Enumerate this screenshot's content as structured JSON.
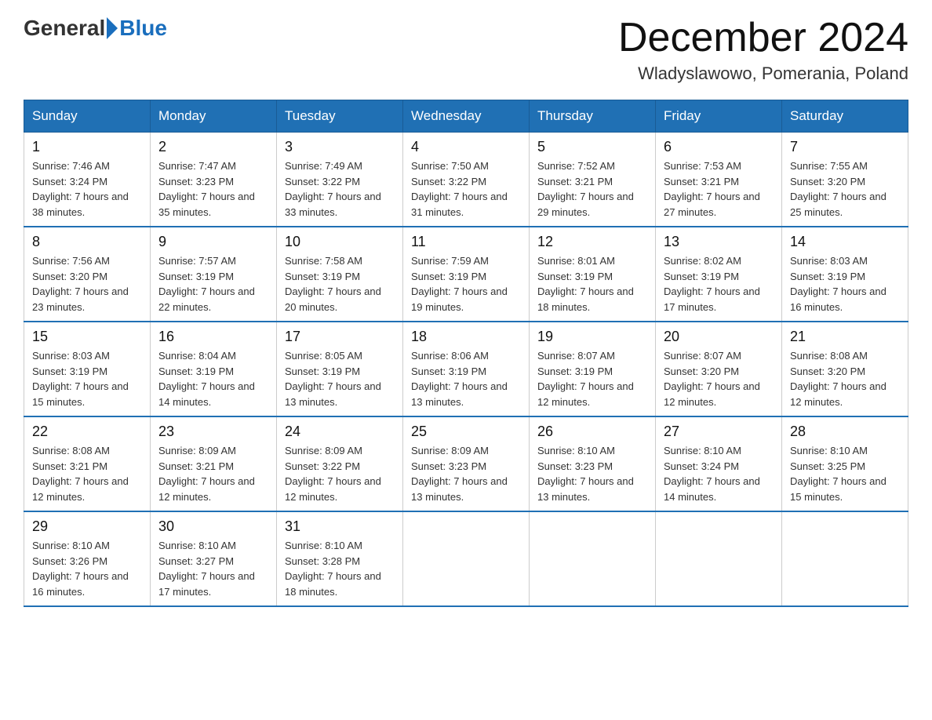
{
  "logo": {
    "general": "General",
    "blue": "Blue"
  },
  "title": "December 2024",
  "location": "Wladyslawowo, Pomerania, Poland",
  "days_of_week": [
    "Sunday",
    "Monday",
    "Tuesday",
    "Wednesday",
    "Thursday",
    "Friday",
    "Saturday"
  ],
  "weeks": [
    [
      {
        "day": "1",
        "sunrise": "7:46 AM",
        "sunset": "3:24 PM",
        "daylight": "7 hours and 38 minutes."
      },
      {
        "day": "2",
        "sunrise": "7:47 AM",
        "sunset": "3:23 PM",
        "daylight": "7 hours and 35 minutes."
      },
      {
        "day": "3",
        "sunrise": "7:49 AM",
        "sunset": "3:22 PM",
        "daylight": "7 hours and 33 minutes."
      },
      {
        "day": "4",
        "sunrise": "7:50 AM",
        "sunset": "3:22 PM",
        "daylight": "7 hours and 31 minutes."
      },
      {
        "day": "5",
        "sunrise": "7:52 AM",
        "sunset": "3:21 PM",
        "daylight": "7 hours and 29 minutes."
      },
      {
        "day": "6",
        "sunrise": "7:53 AM",
        "sunset": "3:21 PM",
        "daylight": "7 hours and 27 minutes."
      },
      {
        "day": "7",
        "sunrise": "7:55 AM",
        "sunset": "3:20 PM",
        "daylight": "7 hours and 25 minutes."
      }
    ],
    [
      {
        "day": "8",
        "sunrise": "7:56 AM",
        "sunset": "3:20 PM",
        "daylight": "7 hours and 23 minutes."
      },
      {
        "day": "9",
        "sunrise": "7:57 AM",
        "sunset": "3:19 PM",
        "daylight": "7 hours and 22 minutes."
      },
      {
        "day": "10",
        "sunrise": "7:58 AM",
        "sunset": "3:19 PM",
        "daylight": "7 hours and 20 minutes."
      },
      {
        "day": "11",
        "sunrise": "7:59 AM",
        "sunset": "3:19 PM",
        "daylight": "7 hours and 19 minutes."
      },
      {
        "day": "12",
        "sunrise": "8:01 AM",
        "sunset": "3:19 PM",
        "daylight": "7 hours and 18 minutes."
      },
      {
        "day": "13",
        "sunrise": "8:02 AM",
        "sunset": "3:19 PM",
        "daylight": "7 hours and 17 minutes."
      },
      {
        "day": "14",
        "sunrise": "8:03 AM",
        "sunset": "3:19 PM",
        "daylight": "7 hours and 16 minutes."
      }
    ],
    [
      {
        "day": "15",
        "sunrise": "8:03 AM",
        "sunset": "3:19 PM",
        "daylight": "7 hours and 15 minutes."
      },
      {
        "day": "16",
        "sunrise": "8:04 AM",
        "sunset": "3:19 PM",
        "daylight": "7 hours and 14 minutes."
      },
      {
        "day": "17",
        "sunrise": "8:05 AM",
        "sunset": "3:19 PM",
        "daylight": "7 hours and 13 minutes."
      },
      {
        "day": "18",
        "sunrise": "8:06 AM",
        "sunset": "3:19 PM",
        "daylight": "7 hours and 13 minutes."
      },
      {
        "day": "19",
        "sunrise": "8:07 AM",
        "sunset": "3:19 PM",
        "daylight": "7 hours and 12 minutes."
      },
      {
        "day": "20",
        "sunrise": "8:07 AM",
        "sunset": "3:20 PM",
        "daylight": "7 hours and 12 minutes."
      },
      {
        "day": "21",
        "sunrise": "8:08 AM",
        "sunset": "3:20 PM",
        "daylight": "7 hours and 12 minutes."
      }
    ],
    [
      {
        "day": "22",
        "sunrise": "8:08 AM",
        "sunset": "3:21 PM",
        "daylight": "7 hours and 12 minutes."
      },
      {
        "day": "23",
        "sunrise": "8:09 AM",
        "sunset": "3:21 PM",
        "daylight": "7 hours and 12 minutes."
      },
      {
        "day": "24",
        "sunrise": "8:09 AM",
        "sunset": "3:22 PM",
        "daylight": "7 hours and 12 minutes."
      },
      {
        "day": "25",
        "sunrise": "8:09 AM",
        "sunset": "3:23 PM",
        "daylight": "7 hours and 13 minutes."
      },
      {
        "day": "26",
        "sunrise": "8:10 AM",
        "sunset": "3:23 PM",
        "daylight": "7 hours and 13 minutes."
      },
      {
        "day": "27",
        "sunrise": "8:10 AM",
        "sunset": "3:24 PM",
        "daylight": "7 hours and 14 minutes."
      },
      {
        "day": "28",
        "sunrise": "8:10 AM",
        "sunset": "3:25 PM",
        "daylight": "7 hours and 15 minutes."
      }
    ],
    [
      {
        "day": "29",
        "sunrise": "8:10 AM",
        "sunset": "3:26 PM",
        "daylight": "7 hours and 16 minutes."
      },
      {
        "day": "30",
        "sunrise": "8:10 AM",
        "sunset": "3:27 PM",
        "daylight": "7 hours and 17 minutes."
      },
      {
        "day": "31",
        "sunrise": "8:10 AM",
        "sunset": "3:28 PM",
        "daylight": "7 hours and 18 minutes."
      },
      null,
      null,
      null,
      null
    ]
  ]
}
